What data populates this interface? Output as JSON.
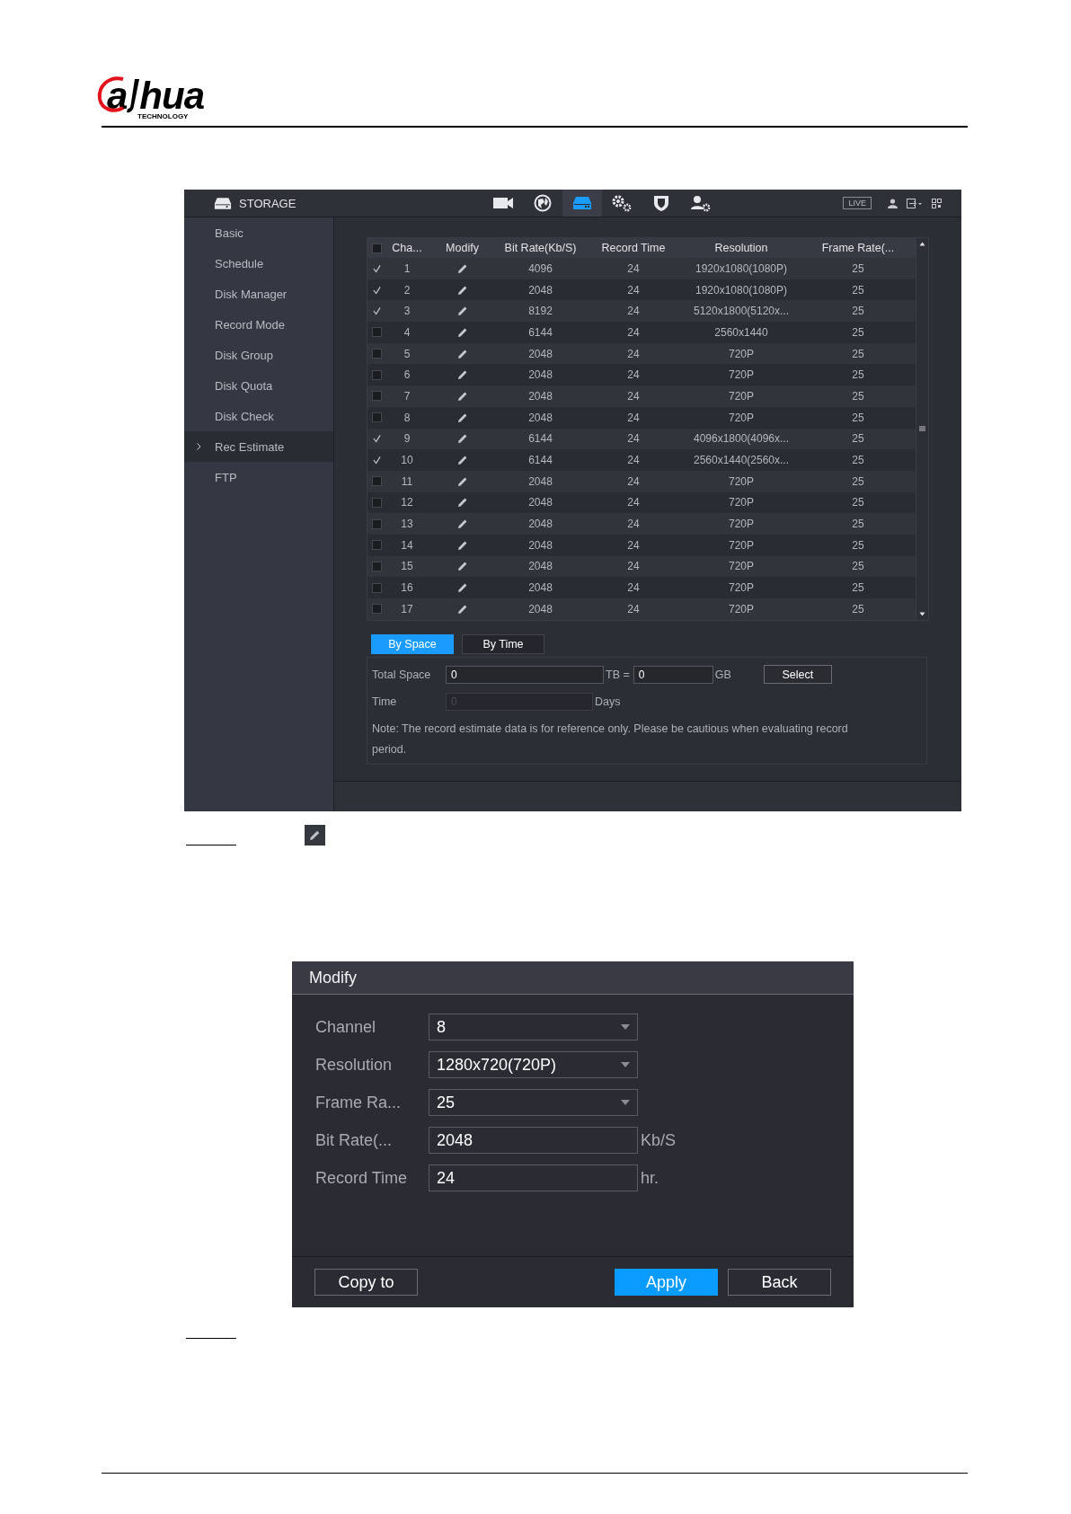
{
  "logo": {
    "letters": [
      "a",
      "hua"
    ],
    "tagline": "TECHNOLOGY"
  },
  "storage_screen": {
    "topbar": {
      "title": "STORAGE",
      "nav_icons": [
        {
          "kind": "camera",
          "selected": false
        },
        {
          "kind": "network",
          "selected": false
        },
        {
          "kind": "storage",
          "selected": true
        },
        {
          "kind": "system",
          "selected": false
        },
        {
          "kind": "security",
          "selected": false
        },
        {
          "kind": "account",
          "selected": false
        }
      ],
      "live_badge": "LIVE"
    },
    "sidebar": {
      "items": [
        {
          "label": "Basic",
          "selected": false
        },
        {
          "label": "Schedule",
          "selected": false
        },
        {
          "label": "Disk Manager",
          "selected": false
        },
        {
          "label": "Record Mode",
          "selected": false
        },
        {
          "label": "Disk Group",
          "selected": false
        },
        {
          "label": "Disk Quota",
          "selected": false
        },
        {
          "label": "Disk Check",
          "selected": false
        },
        {
          "label": "Rec Estimate",
          "selected": true
        },
        {
          "label": "FTP",
          "selected": false
        }
      ]
    },
    "table": {
      "all_checked": false,
      "columns": [
        "Cha...",
        "Modify",
        "Bit Rate(Kb/S)",
        "Record Time",
        "Resolution",
        "Frame Rate(..."
      ],
      "rows": [
        {
          "channel": "1",
          "checked": true,
          "bit_rate": "4096",
          "record_time": "24",
          "resolution": "1920x1080(1080P)",
          "frame_rate": "25"
        },
        {
          "channel": "2",
          "checked": true,
          "bit_rate": "2048",
          "record_time": "24",
          "resolution": "1920x1080(1080P)",
          "frame_rate": "25"
        },
        {
          "channel": "3",
          "checked": true,
          "bit_rate": "8192",
          "record_time": "24",
          "resolution": "5120x1800(5120x...",
          "frame_rate": "25"
        },
        {
          "channel": "4",
          "checked": false,
          "bit_rate": "6144",
          "record_time": "24",
          "resolution": "2560x1440",
          "frame_rate": "25"
        },
        {
          "channel": "5",
          "checked": false,
          "bit_rate": "2048",
          "record_time": "24",
          "resolution": "720P",
          "frame_rate": "25"
        },
        {
          "channel": "6",
          "checked": false,
          "bit_rate": "2048",
          "record_time": "24",
          "resolution": "720P",
          "frame_rate": "25"
        },
        {
          "channel": "7",
          "checked": false,
          "bit_rate": "2048",
          "record_time": "24",
          "resolution": "720P",
          "frame_rate": "25"
        },
        {
          "channel": "8",
          "checked": false,
          "bit_rate": "2048",
          "record_time": "24",
          "resolution": "720P",
          "frame_rate": "25"
        },
        {
          "channel": "9",
          "checked": true,
          "bit_rate": "6144",
          "record_time": "24",
          "resolution": "4096x1800(4096x...",
          "frame_rate": "25"
        },
        {
          "channel": "10",
          "checked": true,
          "bit_rate": "6144",
          "record_time": "24",
          "resolution": "2560x1440(2560x...",
          "frame_rate": "25"
        },
        {
          "channel": "11",
          "checked": false,
          "bit_rate": "2048",
          "record_time": "24",
          "resolution": "720P",
          "frame_rate": "25"
        },
        {
          "channel": "12",
          "checked": false,
          "bit_rate": "2048",
          "record_time": "24",
          "resolution": "720P",
          "frame_rate": "25"
        },
        {
          "channel": "13",
          "checked": false,
          "bit_rate": "2048",
          "record_time": "24",
          "resolution": "720P",
          "frame_rate": "25"
        },
        {
          "channel": "14",
          "checked": false,
          "bit_rate": "2048",
          "record_time": "24",
          "resolution": "720P",
          "frame_rate": "25"
        },
        {
          "channel": "15",
          "checked": false,
          "bit_rate": "2048",
          "record_time": "24",
          "resolution": "720P",
          "frame_rate": "25"
        },
        {
          "channel": "16",
          "checked": false,
          "bit_rate": "2048",
          "record_time": "24",
          "resolution": "720P",
          "frame_rate": "25"
        },
        {
          "channel": "17",
          "checked": false,
          "bit_rate": "2048",
          "record_time": "24",
          "resolution": "720P",
          "frame_rate": "25"
        }
      ]
    },
    "tabs": [
      {
        "label": "By Space",
        "selected": true
      },
      {
        "label": "By Time",
        "selected": false
      }
    ],
    "estimate": {
      "total_space": {
        "label": "Total Space",
        "tb_value": "0",
        "tb_unit": "TB =",
        "gb_value": "0",
        "gb_unit": "GB",
        "button": "Select"
      },
      "time": {
        "label": "Time",
        "placeholder": "0",
        "disabled": true,
        "unit": "Days"
      },
      "note": "Note: The record estimate data is for reference only. Please be cautious when evaluating record period."
    }
  },
  "modify_dialog": {
    "title": "Modify",
    "fields": [
      {
        "kind": "select",
        "label": "Channel",
        "value": "8"
      },
      {
        "kind": "select",
        "label": "Resolution",
        "value": "1280x720(720P)"
      },
      {
        "kind": "select",
        "label": "Frame Ra...",
        "value": "25"
      },
      {
        "kind": "input",
        "label": "Bit Rate(...",
        "value": "2048",
        "unit": "Kb/S"
      },
      {
        "kind": "input",
        "label": "Record Time",
        "value": "24",
        "unit": "hr."
      }
    ],
    "buttons": [
      {
        "label": "Copy to",
        "kind": "default"
      },
      {
        "label": "Apply",
        "kind": "primary"
      },
      {
        "label": "Back",
        "kind": "default"
      }
    ]
  }
}
